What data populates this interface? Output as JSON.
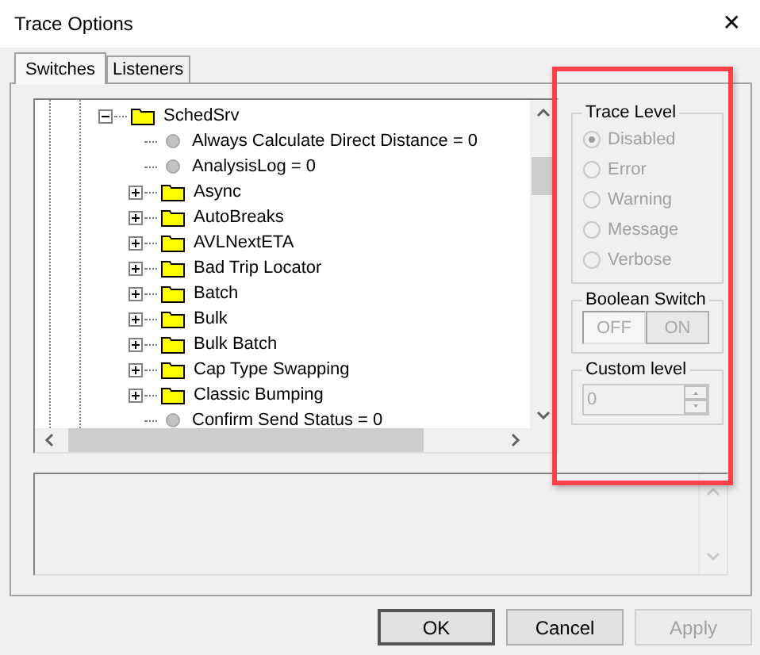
{
  "window": {
    "title": "Trace Options",
    "close": "✕"
  },
  "tabs": [
    {
      "label": "Switches",
      "selected": true
    },
    {
      "label": "Listeners",
      "selected": false
    }
  ],
  "tree": [
    {
      "kind": "folder",
      "label": "SchedSrv",
      "expanded": true,
      "children": [
        {
          "kind": "setting",
          "label": "Always Calculate Direct Distance = 0"
        },
        {
          "kind": "setting",
          "label": "AnalysisLog = 0"
        },
        {
          "kind": "folder",
          "label": "Async",
          "expanded": false
        },
        {
          "kind": "folder",
          "label": "AutoBreaks",
          "expanded": false
        },
        {
          "kind": "folder",
          "label": "AVLNextETA",
          "expanded": false
        },
        {
          "kind": "folder",
          "label": "Bad Trip Locator",
          "expanded": false
        },
        {
          "kind": "folder",
          "label": "Batch",
          "expanded": false
        },
        {
          "kind": "folder",
          "label": "Bulk",
          "expanded": false
        },
        {
          "kind": "folder",
          "label": "Bulk Batch",
          "expanded": false
        },
        {
          "kind": "folder",
          "label": "Cap Type Swapping",
          "expanded": false
        },
        {
          "kind": "folder",
          "label": "Classic Bumping",
          "expanded": false
        },
        {
          "kind": "setting",
          "label": "Confirm Send Status = 0"
        }
      ]
    }
  ],
  "trace_level": {
    "title": "Trace Level",
    "disabled": true,
    "options": [
      {
        "label": "Disabled",
        "selected": true
      },
      {
        "label": "Error",
        "selected": false
      },
      {
        "label": "Warning",
        "selected": false
      },
      {
        "label": "Message",
        "selected": false
      },
      {
        "label": "Verbose",
        "selected": false
      }
    ]
  },
  "boolean_switch": {
    "title": "Boolean Switch",
    "disabled": true,
    "options": [
      {
        "label": "OFF",
        "selected": true
      },
      {
        "label": "ON",
        "selected": false
      }
    ]
  },
  "custom_level": {
    "title": "Custom level",
    "value": "0",
    "disabled": true
  },
  "buttons": [
    {
      "label": "OK",
      "disabled": false,
      "default": true
    },
    {
      "label": "Cancel",
      "disabled": false,
      "default": false
    },
    {
      "label": "Apply",
      "disabled": true,
      "default": false
    }
  ]
}
